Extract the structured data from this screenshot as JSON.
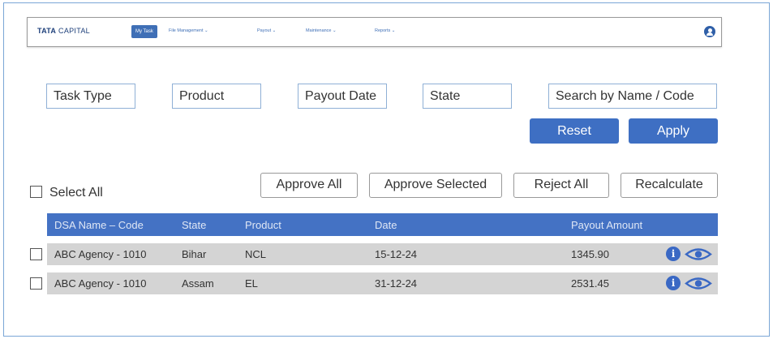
{
  "nav": {
    "logo_bold": "TATA",
    "logo_rest": "CAPITAL",
    "items": [
      {
        "label": "My Task",
        "active": true
      },
      {
        "label": "File Management ⌄"
      },
      {
        "label": "Payout ⌄"
      },
      {
        "label": "Maintenance ⌄"
      },
      {
        "label": "Reports ⌄"
      }
    ],
    "user_icon": "user-avatar-icon"
  },
  "filters": {
    "task_type": "Task Type",
    "product": "Product",
    "payout_date": "Payout Date",
    "state": "State",
    "search": "Search by Name / Code"
  },
  "buttons": {
    "reset": "Reset",
    "apply": "Apply",
    "approve_all": "Approve All",
    "approve_selected": "Approve Selected",
    "reject_all": "Reject All",
    "recalculate": "Recalculate"
  },
  "select_all": "Select All",
  "table": {
    "columns": [
      "DSA Name – Code",
      "State",
      "Product",
      "Date",
      "Payout Amount"
    ],
    "rows": [
      [
        "ABC Agency - 1010",
        "Bihar",
        "NCL",
        "15-12-24",
        "1345.90"
      ],
      [
        "ABC Agency - 1010",
        "Assam",
        "EL",
        "31-12-24",
        "2531.45"
      ]
    ],
    "row_icons": [
      "info-icon",
      "eye-icon"
    ]
  },
  "colors": {
    "primary": "#3e6fc3",
    "header_bg": "#4472c4",
    "row_bg": "#d4d4d4",
    "filter_border": "#8fb0d6"
  }
}
